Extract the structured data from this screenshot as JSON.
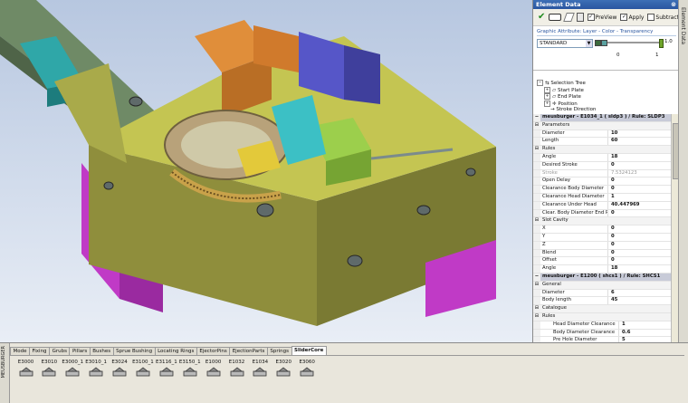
{
  "panel": {
    "title": "Element Data",
    "side_tab": "Element Data",
    "toolbar": {
      "preview_label": "PreView",
      "apply_label": "Apply",
      "subtract_label": "Subtract",
      "preview_checked": true,
      "apply_checked": true,
      "subtract_checked": false
    },
    "attributes": {
      "title": "Graphic Attribute: Layer - Color - Transparency",
      "layer_value": "STANDARD",
      "slider_value": "1.0",
      "range_min": "0",
      "range_max": "1",
      "transparency": 1.0,
      "color_swatch": "#3c6a3c",
      "color_swatch_2": "#5aa1a0"
    },
    "tree": {
      "root": "Selection Tree",
      "items": [
        "Start Plate",
        "End Plate",
        "Position",
        "Stroke Direction"
      ]
    },
    "properties": [
      {
        "type": "head",
        "label": "meusburger - E1034_1 ( sldp3 )  / Rule: SLDP3"
      },
      {
        "type": "cat",
        "label": "Parameters"
      },
      {
        "type": "row",
        "name": "Diameter",
        "value": "10"
      },
      {
        "type": "row",
        "name": "Length",
        "value": "60"
      },
      {
        "type": "cat",
        "label": "Rules"
      },
      {
        "type": "row",
        "name": "Angle",
        "value": "18"
      },
      {
        "type": "row",
        "name": "Desired Stroke",
        "value": "0"
      },
      {
        "type": "dis",
        "name": "Stroke",
        "value": "7.5324123"
      },
      {
        "type": "row",
        "name": "Open Delay",
        "value": "0"
      },
      {
        "type": "row",
        "name": "Clearance Body Diameter",
        "value": "0"
      },
      {
        "type": "row",
        "name": "Clearance Head Diameter",
        "value": "1"
      },
      {
        "type": "row",
        "name": "Clearance Under Head",
        "value": "40.447969"
      },
      {
        "type": "row",
        "name": "Clear. Body Diameter End Plate",
        "value": "0"
      },
      {
        "type": "cat",
        "label": "Slot Cavity"
      },
      {
        "type": "row",
        "name": "X",
        "value": "0"
      },
      {
        "type": "row",
        "name": "Y",
        "value": "0"
      },
      {
        "type": "row",
        "name": "Z",
        "value": "0"
      },
      {
        "type": "row",
        "name": "Blend",
        "value": "0"
      },
      {
        "type": "row",
        "name": "Offset",
        "value": "0"
      },
      {
        "type": "row",
        "name": "Angle",
        "value": "18"
      },
      {
        "type": "head",
        "label": "meusburger - E1200 ( shcs1 )  / Rule: SHCS1"
      },
      {
        "type": "cat",
        "label": "General"
      },
      {
        "type": "row",
        "name": "Diameter",
        "value": "6"
      },
      {
        "type": "row",
        "name": "Body length",
        "value": "45"
      },
      {
        "type": "cat",
        "label": "Catalogue"
      },
      {
        "type": "cat",
        "label": "Rules"
      },
      {
        "type": "sub",
        "name": "Head Diameter Clearance",
        "value": "1"
      },
      {
        "type": "sub",
        "name": "Body Diameter Clearance",
        "value": "0.6"
      },
      {
        "type": "sub",
        "name": "Pre Hole Diameter",
        "value": "5"
      }
    ]
  },
  "bottom": {
    "side_tab": "MEUSBURGER",
    "tabs": [
      "Mode",
      "Fixing",
      "Grubs",
      "Pillars",
      "Bushes",
      "Sprue Bushing",
      "Locating Rings",
      "EjectorPins",
      "EjectionParts",
      "Springs",
      "SliderCore"
    ],
    "active_tab": "SliderCore",
    "elements": [
      "E3000",
      "E3010",
      "E3000_1",
      "E3010_1",
      "E3024",
      "E3100_1",
      "E3116_1",
      "E3150_1",
      "E1000",
      "E1032",
      "E1034",
      "E3020",
      "E3060"
    ]
  }
}
